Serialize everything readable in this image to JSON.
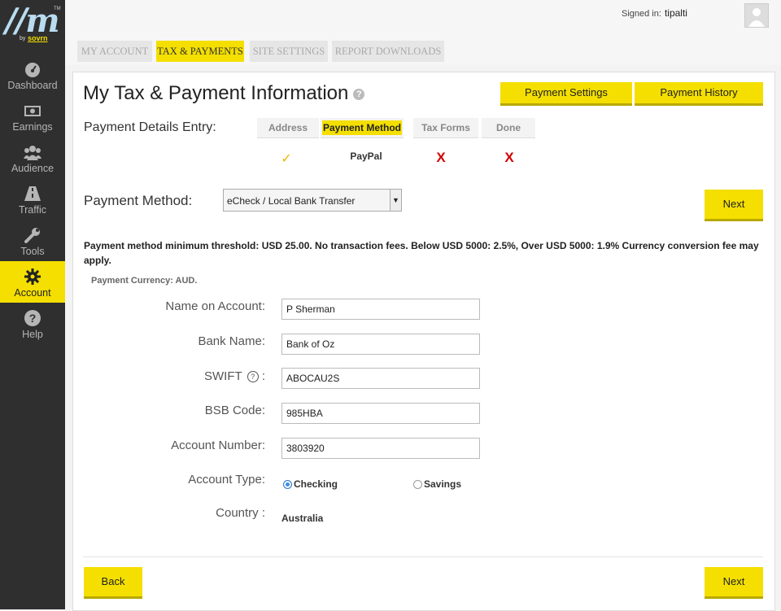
{
  "logo": {
    "mark": "//m",
    "tm": "TM",
    "by": "by",
    "brand": "sovrn"
  },
  "sidebar": {
    "items": [
      {
        "label": "Dashboard",
        "icon": "dashboard-icon"
      },
      {
        "label": "Earnings",
        "icon": "money-icon"
      },
      {
        "label": "Audience",
        "icon": "users-icon"
      },
      {
        "label": "Traffic",
        "icon": "road-icon"
      },
      {
        "label": "Tools",
        "icon": "wrench-icon"
      },
      {
        "label": "Account",
        "icon": "gear-icon",
        "active": true
      },
      {
        "label": "Help",
        "icon": "help-icon"
      }
    ]
  },
  "header": {
    "signed_in_label": "Signed in:",
    "user": "tipalti"
  },
  "tabs": [
    {
      "label": "MY ACCOUNT"
    },
    {
      "label": "TAX & PAYMENTS",
      "active": true
    },
    {
      "label": "SITE SETTINGS"
    },
    {
      "label": "REPORT DOWNLOADS"
    }
  ],
  "page": {
    "title": "My Tax & Payment Information",
    "help_glyph": "?",
    "payment_settings_label": "Payment Settings",
    "payment_history_label": "Payment History",
    "details_entry_label": "Payment Details Entry:"
  },
  "steps": [
    {
      "label": "Address",
      "value": "✓",
      "status": "done"
    },
    {
      "label": "Payment Method",
      "value": "PayPal",
      "status": "current"
    },
    {
      "label": "Tax Forms",
      "value": "X",
      "status": "missing"
    },
    {
      "label": "Done",
      "value": "X",
      "status": "missing"
    }
  ],
  "payment_method": {
    "label": "Payment Method:",
    "selected": "eCheck / Local Bank Transfer",
    "next_label": "Next"
  },
  "note": "Payment method minimum threshold: USD 25.00. No transaction fees. Below USD 5000: 2.5%, Over USD 5000: 1.9% Currency conversion fee may apply.",
  "currency": "Payment Currency:  AUD.",
  "form": {
    "name_label": "Name on Account:",
    "name_value": "P Sherman",
    "bank_label": "Bank Name:",
    "bank_value": "Bank of Oz",
    "swift_label": "SWIFT",
    "swift_colon": ":",
    "swift_value": "ABOCAU2S",
    "bsb_label": "BSB Code:",
    "bsb_value": "985HBA",
    "account_label": "Account Number:",
    "account_value": "3803920",
    "type_label": "Account Type:",
    "type_checking": "Checking",
    "type_savings": "Savings",
    "country_label": "Country :",
    "country_value": "Australia"
  },
  "footer": {
    "back_label": "Back",
    "next_label": "Next"
  },
  "colors": {
    "accent": "#f4df00",
    "sidebar": "#2f2f2f",
    "error": "#d40000",
    "check": "#f0b400"
  }
}
